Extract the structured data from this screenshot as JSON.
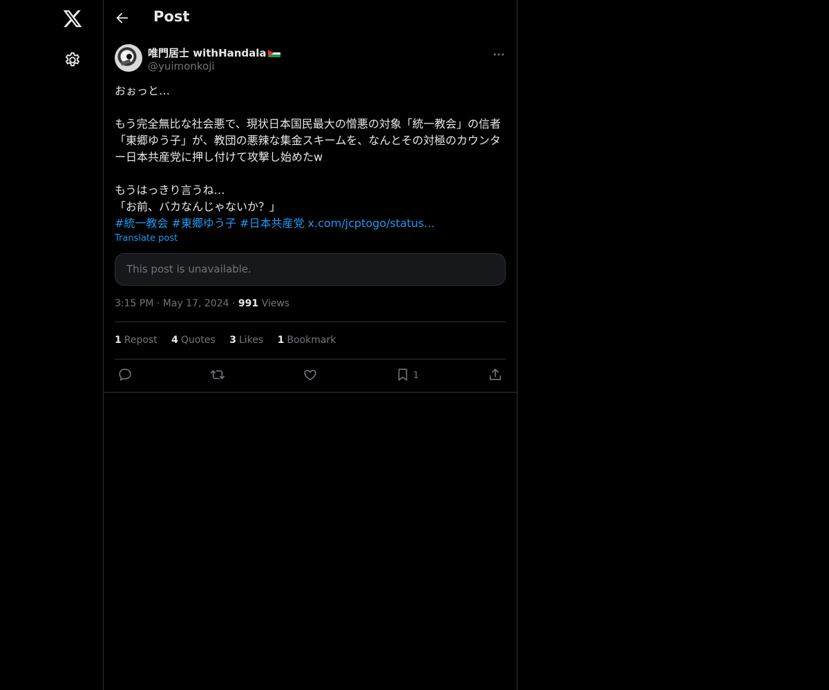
{
  "header": {
    "title": "Post"
  },
  "author": {
    "display_name": "唯門居士 withHandala",
    "handle": "@yuimonkoji"
  },
  "post": {
    "text": "おぉっと…\n\nもう完全無比な社会悪で、現状日本国民最大の憎悪の対象「統一教会」の信者「東郷ゆう子」が、教団の悪辣な集金スキームを、なんとその対極のカウンター日本共産党に押し付けて攻撃し始めたw\n\nもうはっきり言うね…\n「お前、バカなんじゃないか？」",
    "hashtags": [
      "#統一教会",
      "#東郷ゆう子",
      "#日本共産党"
    ],
    "link": "x.com/jcptogo/status…",
    "translate_label": "Translate post",
    "quoted_unavailable": "This post is unavailable."
  },
  "meta": {
    "time": "3:15 PM",
    "date": "May 17, 2024",
    "views_count": "991",
    "views_label": "Views"
  },
  "stats": [
    {
      "count": "1",
      "label": "Repost"
    },
    {
      "count": "4",
      "label": "Quotes"
    },
    {
      "count": "3",
      "label": "Likes"
    },
    {
      "count": "1",
      "label": "Bookmark"
    }
  ],
  "actions": {
    "bookmark_count": "1"
  },
  "icons": [
    "x-logo-icon",
    "gear-icon",
    "back-arrow-icon",
    "more-icon",
    "reply-icon",
    "repost-icon",
    "like-icon",
    "bookmark-icon",
    "share-icon"
  ],
  "colors": {
    "link": "#1d9bf0",
    "text": "#e7e9ea",
    "muted": "#71767b",
    "border": "#2f3336",
    "background": "#000000"
  }
}
